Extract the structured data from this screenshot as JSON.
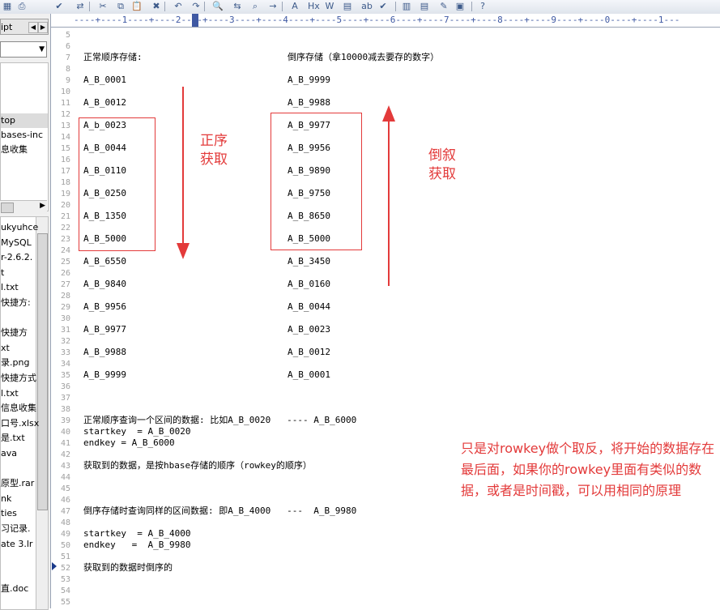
{
  "toolbar": {
    "icons": [
      "table-icon",
      "print-icon",
      "spellcheck-icon",
      "toggle-icon",
      "cut-icon",
      "copy-icon",
      "paste-icon",
      "delete-icon",
      "undo-icon",
      "redo-icon",
      "find-icon",
      "replace-icon",
      "find-in-files-icon",
      "goto-icon",
      "font-icon",
      "hex-icon",
      "word-wrap-icon",
      "column-mode-icon",
      "abc-icon",
      "check-icon",
      "list-icon",
      "doc-icon",
      "edit-icon",
      "window-icon",
      "help-icon"
    ]
  },
  "left_panel": {
    "tab_label": "ipt",
    "dropdown_value": "",
    "tree": [
      "top",
      "bases-inc",
      "息收集"
    ],
    "files": [
      "ukyuhce",
      "MySQL",
      "r-2.6.2.",
      "t",
      "l.txt",
      "快捷方:",
      "",
      "快捷方",
      "xt",
      "录.png",
      "快捷方式",
      "l.txt",
      "信息收集",
      "口号.xlsx",
      "是.txt",
      "ava",
      "",
      "原型.rar",
      "nk",
      "ties",
      "习记录.",
      "ate 3.lr",
      "",
      "",
      "直.doc"
    ]
  },
  "ruler_text": "----+----1----+----2----+----3----+----4----+----5----+----6----+----7----+----8----+----9----+----0----+----1---",
  "editor": {
    "line_numbers": [
      "5",
      "6",
      "7",
      "8",
      "9",
      "10",
      "11",
      "12",
      "13",
      "14",
      "15",
      "16",
      "17",
      "18",
      "19",
      "20",
      "21",
      "22",
      "23",
      "24",
      "25",
      "26",
      "27",
      "28",
      "29",
      "30",
      "31",
      "32",
      "33",
      "34",
      "35",
      "36",
      "37",
      "38",
      "39",
      "40",
      "41",
      "42",
      "43",
      "44",
      "45",
      "46",
      "47",
      "48",
      "49",
      "50",
      "51",
      "52",
      "53",
      "54",
      "55"
    ],
    "left_header": "正常顺序存储:",
    "right_header": "倒序存储（拿10000减去要存的数字）",
    "left_col": [
      "A_B_0001",
      "A_B_0012",
      "A_b_0023",
      "A_B_0044",
      "A_B_0110",
      "A_B_0250",
      "A_B_1350",
      "A_B_5000",
      "A_B_6550",
      "A_B_9840",
      "A_B_9956",
      "A_B_9977",
      "A_B_9988",
      "A_B_9999"
    ],
    "right_col": [
      "A_B_9999",
      "A_B_9988",
      "A_B_9977",
      "A_B_9956",
      "A_B_9890",
      "A_B_9750",
      "A_B_8650",
      "A_B_5000",
      "A_B_3450",
      "A_B_0160",
      "A_B_0044",
      "A_B_0023",
      "A_B_0012",
      "A_B_0001"
    ],
    "line39": "正常顺序查询一个区间的数据: 比如A_B_0020   ---- A_B_6000",
    "line40": "startkey  = A_B_0020",
    "line41": "endkey = A_B_6000",
    "line43": "获取到的数据，是按hbase存储的顺序（rowkey的顺序）",
    "line46": "倒序存储时查询同样的区间数据: 即A_B_4000   ---  A_B_9980",
    "line48": "startkey  = A_B_4000",
    "line49": "endkey   =  A_B_9980",
    "line52": "获取到的数据时倒序的"
  },
  "annotations": {
    "forward_label_1": "正序",
    "forward_label_2": "获取",
    "reverse_label_1": "倒叙",
    "reverse_label_2": "获取",
    "note": "只是对rowkey做个取反，将开始的数据存在最后面，如果你的rowkey里面有类似的数据，或者是时间戳，可以用相同的原理",
    "color": "#e33a3a"
  }
}
